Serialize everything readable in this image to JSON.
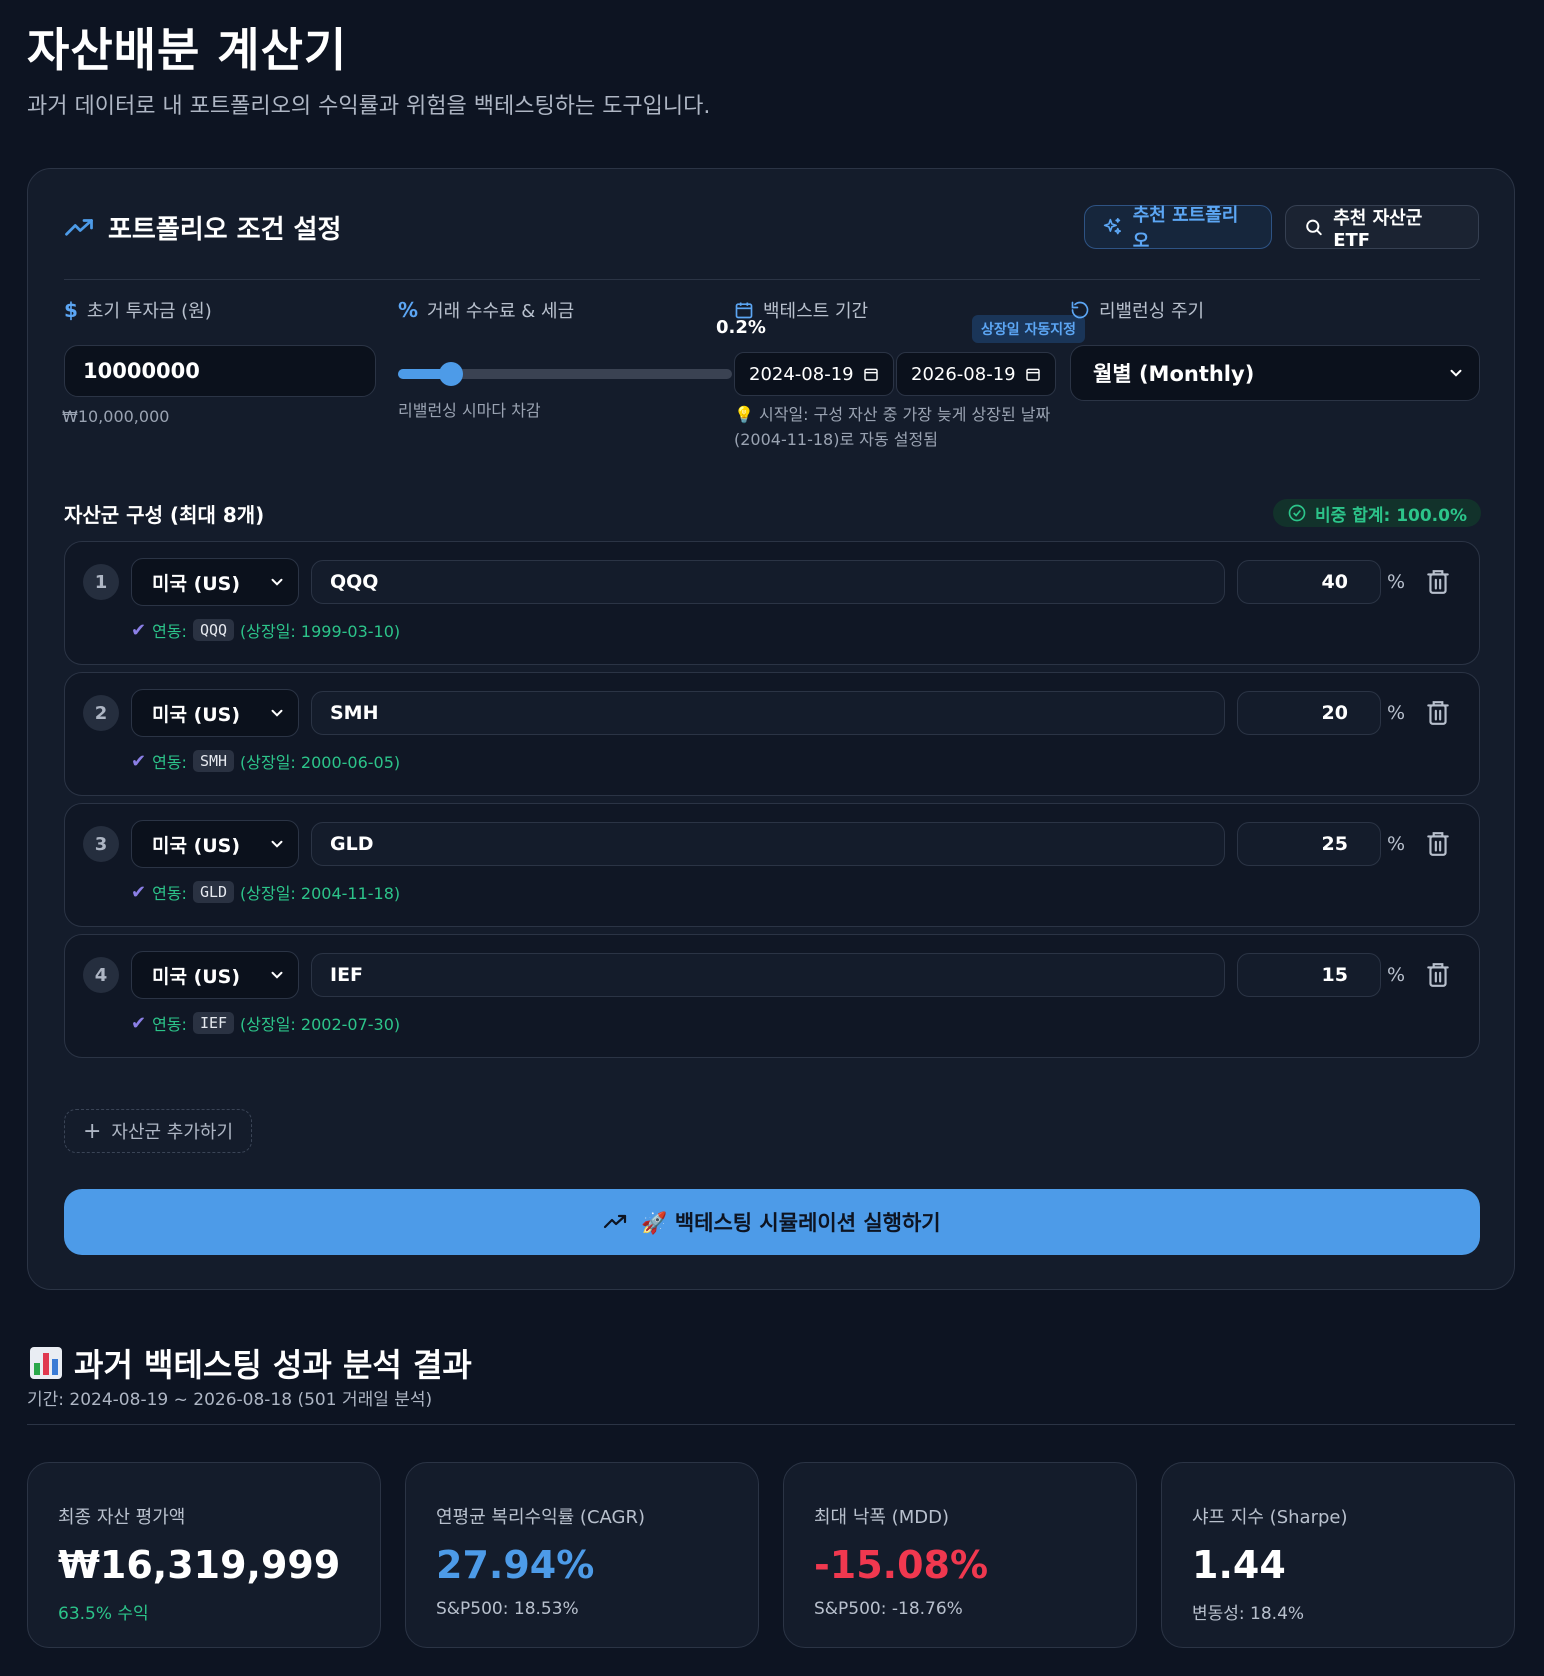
{
  "header": {
    "title": "자산배분 계산기",
    "subtitle": "과거 데이터로 내 포트폴리오의 수익률과 위험을 백테스팅하는 도구입니다."
  },
  "settings": {
    "title": "포트폴리오 조건 설정",
    "recommend_portfolio_label": "추천 포트폴리오",
    "recommend_etf_label": "추천 자산군 ETF",
    "initial_investment": {
      "label": "초기 투자금 (원)",
      "value": "10000000",
      "formatted": "₩10,000,000"
    },
    "fee": {
      "label": "거래 수수료 & 세금",
      "value_text": "0.2%",
      "slider_fraction": 0.16,
      "hint": "리밸런싱 시마다 차감"
    },
    "period": {
      "label": "백테스트 기간",
      "auto_badge": "상장일 자동지정",
      "start": "2024-08-19",
      "end": "2026-08-19",
      "hint": "💡 시작일: 구성 자산 중 가장 늦게 상장된 날짜 (2004-11-18)로 자동 설정됨"
    },
    "rebalance": {
      "label": "리밸런싱 주기",
      "selected": "월별 (Monthly)"
    }
  },
  "assets": {
    "title": "자산군 구성 (최대 8개)",
    "sum_label": "비중 합계: 100.0%",
    "linked_prefix": "연동:",
    "pct_symbol": "%",
    "items": [
      {
        "num": "1",
        "market": "미국 (US)",
        "ticker": "QQQ",
        "weight": "40",
        "code": "QQQ",
        "listing": "(상장일: 1999-03-10)"
      },
      {
        "num": "2",
        "market": "미국 (US)",
        "ticker": "SMH",
        "weight": "20",
        "code": "SMH",
        "listing": "(상장일: 2000-06-05)"
      },
      {
        "num": "3",
        "market": "미국 (US)",
        "ticker": "GLD",
        "weight": "25",
        "code": "GLD",
        "listing": "(상장일: 2004-11-18)"
      },
      {
        "num": "4",
        "market": "미국 (US)",
        "ticker": "IEF",
        "weight": "15",
        "code": "IEF",
        "listing": "(상장일: 2002-07-30)"
      }
    ],
    "add_label": "자산군 추가하기"
  },
  "run_button": {
    "label": "🚀 백테스팅 시뮬레이션 실행하기"
  },
  "results": {
    "title": "과거 백테스팅 성과 분석 결과",
    "period": "기간: 2024-08-19 ~ 2026-08-18 (501 거래일 분석)",
    "metrics": [
      {
        "label": "최종 자산 평가액",
        "value": "₩16,319,999",
        "sub": "63.5% 수익",
        "value_color": "#ffffff",
        "sub_color": "#2cc48a"
      },
      {
        "label": "연평균 복리수익률 (CAGR)",
        "value": "27.94%",
        "sub": "S&P500: 18.53%",
        "value_color": "#4d9be8",
        "sub_color": "#b8c0cd"
      },
      {
        "label": "최대 낙폭 (MDD)",
        "value": "-15.08%",
        "sub": "S&P500: -18.76%",
        "value_color": "#f0384f",
        "sub_color": "#b8c0cd"
      },
      {
        "label": "샤프 지수 (Sharpe)",
        "value": "1.44",
        "sub": "변동성: 18.4%",
        "value_color": "#ffffff",
        "sub_color": "#b8c0cd"
      }
    ]
  },
  "colors": {
    "background": "#0d1422",
    "card": "#141c2b",
    "accent": "#4d9be8",
    "success": "#2cc48a",
    "danger": "#f0384f"
  }
}
